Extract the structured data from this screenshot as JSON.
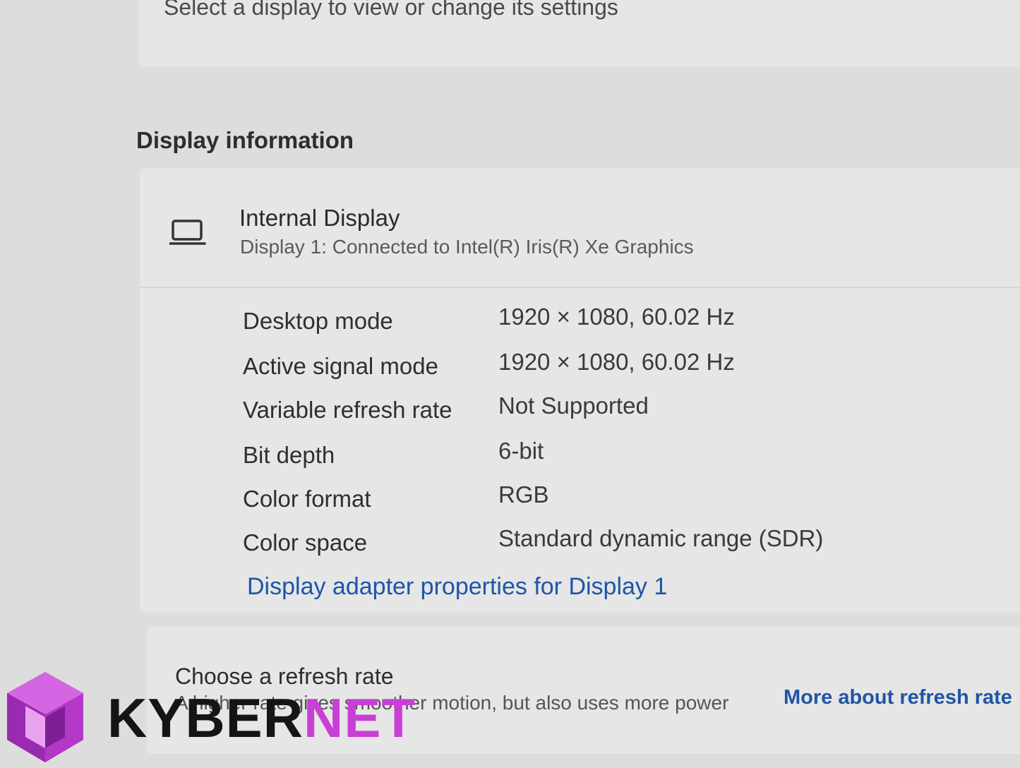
{
  "select_display_text": "Select a display to view or change its settings",
  "display_info": {
    "section_title": "Display information",
    "display_name": "Internal Display",
    "display_subtitle": "Display 1: Connected to Intel(R) Iris(R) Xe Graphics",
    "icon": "laptop-icon",
    "rows": [
      {
        "label": "Desktop mode",
        "value": "1920 × 1080, 60.02 Hz"
      },
      {
        "label": "Active signal mode",
        "value": "1920 × 1080, 60.02 Hz"
      },
      {
        "label": "Variable refresh rate",
        "value": "Not Supported"
      },
      {
        "label": "Bit depth",
        "value": "6-bit"
      },
      {
        "label": "Color format",
        "value": "RGB"
      },
      {
        "label": "Color space",
        "value": "Standard dynamic range (SDR)"
      }
    ],
    "adapter_link": "Display adapter properties for Display 1"
  },
  "refresh_rate": {
    "title": "Choose a refresh rate",
    "description": "A higher rate gives smoother motion, but also uses more power",
    "link": "More about refresh rate"
  },
  "watermark": {
    "text_part1": "KYBER",
    "text_part2": "NET",
    "logo_color": "#c83fd6",
    "icon": "kybernet-logo-icon"
  },
  "colors": {
    "background": "#dddddd",
    "card": "#e6e6e6",
    "link": "#1e55a8",
    "brand": "#c83fd6"
  }
}
